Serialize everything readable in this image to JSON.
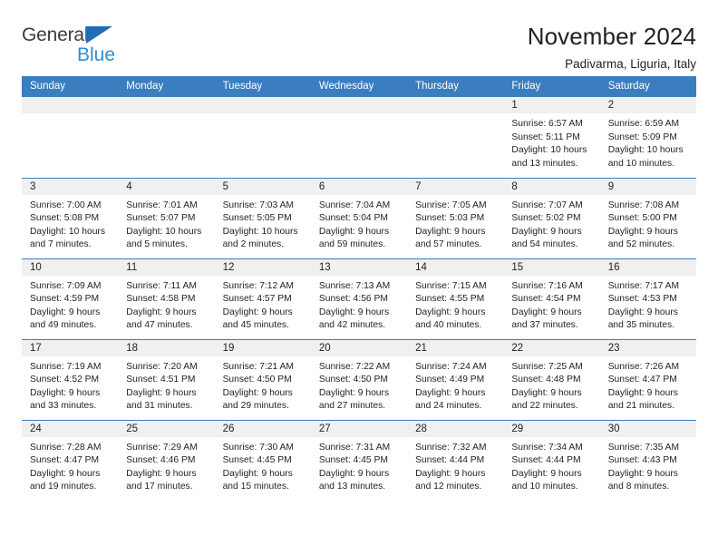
{
  "brand": {
    "name_part1": "General",
    "name_part2": "Blue",
    "accent_color": "#2b8fd4",
    "triangle_color": "#1f6eb5",
    "triangle_icon": "triangle-icon"
  },
  "header": {
    "title": "November 2024",
    "subtitle": "Padivarma, Liguria, Italy"
  },
  "calendar": {
    "header_bg": "#3a7ec0",
    "daynum_bg": "#f0f0f0",
    "weekdays": [
      "Sunday",
      "Monday",
      "Tuesday",
      "Wednesday",
      "Thursday",
      "Friday",
      "Saturday"
    ],
    "weeks": [
      [
        {
          "day": "",
          "l1": "",
          "l2": "",
          "l3": "",
          "l4": ""
        },
        {
          "day": "",
          "l1": "",
          "l2": "",
          "l3": "",
          "l4": ""
        },
        {
          "day": "",
          "l1": "",
          "l2": "",
          "l3": "",
          "l4": ""
        },
        {
          "day": "",
          "l1": "",
          "l2": "",
          "l3": "",
          "l4": ""
        },
        {
          "day": "",
          "l1": "",
          "l2": "",
          "l3": "",
          "l4": ""
        },
        {
          "day": "1",
          "l1": "Sunrise: 6:57 AM",
          "l2": "Sunset: 5:11 PM",
          "l3": "Daylight: 10 hours",
          "l4": "and 13 minutes."
        },
        {
          "day": "2",
          "l1": "Sunrise: 6:59 AM",
          "l2": "Sunset: 5:09 PM",
          "l3": "Daylight: 10 hours",
          "l4": "and 10 minutes."
        }
      ],
      [
        {
          "day": "3",
          "l1": "Sunrise: 7:00 AM",
          "l2": "Sunset: 5:08 PM",
          "l3": "Daylight: 10 hours",
          "l4": "and 7 minutes."
        },
        {
          "day": "4",
          "l1": "Sunrise: 7:01 AM",
          "l2": "Sunset: 5:07 PM",
          "l3": "Daylight: 10 hours",
          "l4": "and 5 minutes."
        },
        {
          "day": "5",
          "l1": "Sunrise: 7:03 AM",
          "l2": "Sunset: 5:05 PM",
          "l3": "Daylight: 10 hours",
          "l4": "and 2 minutes."
        },
        {
          "day": "6",
          "l1": "Sunrise: 7:04 AM",
          "l2": "Sunset: 5:04 PM",
          "l3": "Daylight: 9 hours",
          "l4": "and 59 minutes."
        },
        {
          "day": "7",
          "l1": "Sunrise: 7:05 AM",
          "l2": "Sunset: 5:03 PM",
          "l3": "Daylight: 9 hours",
          "l4": "and 57 minutes."
        },
        {
          "day": "8",
          "l1": "Sunrise: 7:07 AM",
          "l2": "Sunset: 5:02 PM",
          "l3": "Daylight: 9 hours",
          "l4": "and 54 minutes."
        },
        {
          "day": "9",
          "l1": "Sunrise: 7:08 AM",
          "l2": "Sunset: 5:00 PM",
          "l3": "Daylight: 9 hours",
          "l4": "and 52 minutes."
        }
      ],
      [
        {
          "day": "10",
          "l1": "Sunrise: 7:09 AM",
          "l2": "Sunset: 4:59 PM",
          "l3": "Daylight: 9 hours",
          "l4": "and 49 minutes."
        },
        {
          "day": "11",
          "l1": "Sunrise: 7:11 AM",
          "l2": "Sunset: 4:58 PM",
          "l3": "Daylight: 9 hours",
          "l4": "and 47 minutes."
        },
        {
          "day": "12",
          "l1": "Sunrise: 7:12 AM",
          "l2": "Sunset: 4:57 PM",
          "l3": "Daylight: 9 hours",
          "l4": "and 45 minutes."
        },
        {
          "day": "13",
          "l1": "Sunrise: 7:13 AM",
          "l2": "Sunset: 4:56 PM",
          "l3": "Daylight: 9 hours",
          "l4": "and 42 minutes."
        },
        {
          "day": "14",
          "l1": "Sunrise: 7:15 AM",
          "l2": "Sunset: 4:55 PM",
          "l3": "Daylight: 9 hours",
          "l4": "and 40 minutes."
        },
        {
          "day": "15",
          "l1": "Sunrise: 7:16 AM",
          "l2": "Sunset: 4:54 PM",
          "l3": "Daylight: 9 hours",
          "l4": "and 37 minutes."
        },
        {
          "day": "16",
          "l1": "Sunrise: 7:17 AM",
          "l2": "Sunset: 4:53 PM",
          "l3": "Daylight: 9 hours",
          "l4": "and 35 minutes."
        }
      ],
      [
        {
          "day": "17",
          "l1": "Sunrise: 7:19 AM",
          "l2": "Sunset: 4:52 PM",
          "l3": "Daylight: 9 hours",
          "l4": "and 33 minutes."
        },
        {
          "day": "18",
          "l1": "Sunrise: 7:20 AM",
          "l2": "Sunset: 4:51 PM",
          "l3": "Daylight: 9 hours",
          "l4": "and 31 minutes."
        },
        {
          "day": "19",
          "l1": "Sunrise: 7:21 AM",
          "l2": "Sunset: 4:50 PM",
          "l3": "Daylight: 9 hours",
          "l4": "and 29 minutes."
        },
        {
          "day": "20",
          "l1": "Sunrise: 7:22 AM",
          "l2": "Sunset: 4:50 PM",
          "l3": "Daylight: 9 hours",
          "l4": "and 27 minutes."
        },
        {
          "day": "21",
          "l1": "Sunrise: 7:24 AM",
          "l2": "Sunset: 4:49 PM",
          "l3": "Daylight: 9 hours",
          "l4": "and 24 minutes."
        },
        {
          "day": "22",
          "l1": "Sunrise: 7:25 AM",
          "l2": "Sunset: 4:48 PM",
          "l3": "Daylight: 9 hours",
          "l4": "and 22 minutes."
        },
        {
          "day": "23",
          "l1": "Sunrise: 7:26 AM",
          "l2": "Sunset: 4:47 PM",
          "l3": "Daylight: 9 hours",
          "l4": "and 21 minutes."
        }
      ],
      [
        {
          "day": "24",
          "l1": "Sunrise: 7:28 AM",
          "l2": "Sunset: 4:47 PM",
          "l3": "Daylight: 9 hours",
          "l4": "and 19 minutes."
        },
        {
          "day": "25",
          "l1": "Sunrise: 7:29 AM",
          "l2": "Sunset: 4:46 PM",
          "l3": "Daylight: 9 hours",
          "l4": "and 17 minutes."
        },
        {
          "day": "26",
          "l1": "Sunrise: 7:30 AM",
          "l2": "Sunset: 4:45 PM",
          "l3": "Daylight: 9 hours",
          "l4": "and 15 minutes."
        },
        {
          "day": "27",
          "l1": "Sunrise: 7:31 AM",
          "l2": "Sunset: 4:45 PM",
          "l3": "Daylight: 9 hours",
          "l4": "and 13 minutes."
        },
        {
          "day": "28",
          "l1": "Sunrise: 7:32 AM",
          "l2": "Sunset: 4:44 PM",
          "l3": "Daylight: 9 hours",
          "l4": "and 12 minutes."
        },
        {
          "day": "29",
          "l1": "Sunrise: 7:34 AM",
          "l2": "Sunset: 4:44 PM",
          "l3": "Daylight: 9 hours",
          "l4": "and 10 minutes."
        },
        {
          "day": "30",
          "l1": "Sunrise: 7:35 AM",
          "l2": "Sunset: 4:43 PM",
          "l3": "Daylight: 9 hours",
          "l4": "and 8 minutes."
        }
      ]
    ]
  }
}
